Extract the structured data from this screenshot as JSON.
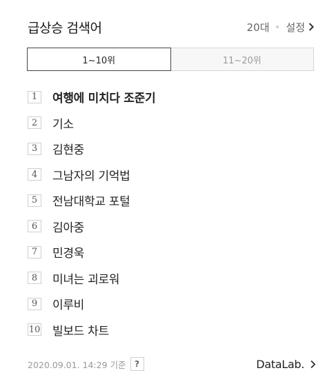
{
  "header": {
    "title": "급상승 검색어",
    "age_filter": "20대",
    "settings_label": "설정"
  },
  "tabs": [
    {
      "label": "1~10위",
      "active": true
    },
    {
      "label": "11~20위",
      "active": false
    }
  ],
  "ranking": [
    {
      "rank": "1",
      "keyword": "여행에 미치다 조준기"
    },
    {
      "rank": "2",
      "keyword": "기소"
    },
    {
      "rank": "3",
      "keyword": "김현중"
    },
    {
      "rank": "4",
      "keyword": "그남자의 기억법"
    },
    {
      "rank": "5",
      "keyword": "전남대학교 포털"
    },
    {
      "rank": "6",
      "keyword": "김아중"
    },
    {
      "rank": "7",
      "keyword": "민경욱"
    },
    {
      "rank": "8",
      "keyword": "미녀는 괴로워"
    },
    {
      "rank": "9",
      "keyword": "이루비"
    },
    {
      "rank": "10",
      "keyword": "빌보드 차트"
    }
  ],
  "footer": {
    "timestamp": "2020.09.01. 14:29 기준",
    "help_label": "?",
    "datalab_label": "DataLab."
  },
  "icons": {
    "settings_chevron": "chevron-right-icon",
    "datalab_chevron": "chevron-right-icon"
  }
}
